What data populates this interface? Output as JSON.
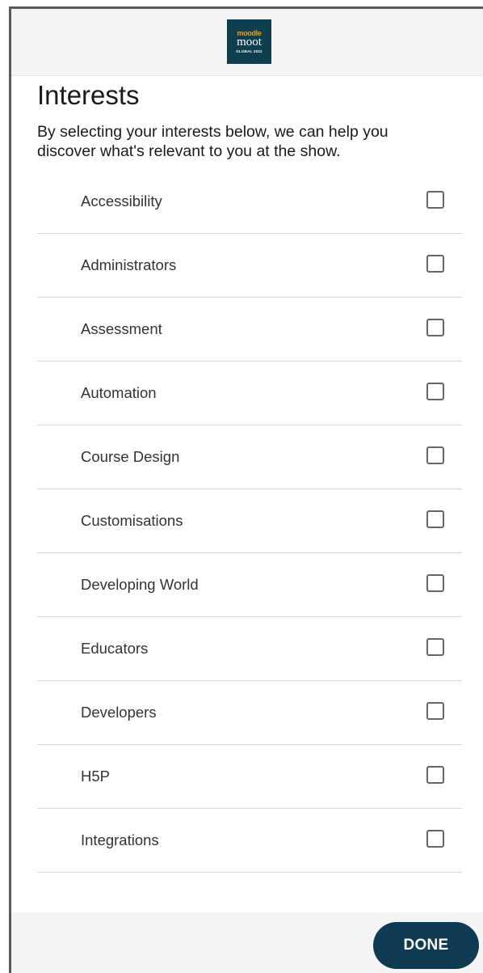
{
  "header": {
    "logo": {
      "text_top": "moodle",
      "text_mid": "moot",
      "text_bottom": "GLOBAL 2022",
      "background": "#0e3f4f",
      "accent": "#f39c12"
    }
  },
  "page": {
    "title": "Interests",
    "intro": "By selecting your interests below, we can help you discover what's relevant to you at the show."
  },
  "interests": [
    {
      "label": "Accessibility",
      "checked": false
    },
    {
      "label": "Administrators",
      "checked": false
    },
    {
      "label": "Assessment",
      "checked": false
    },
    {
      "label": "Automation",
      "checked": false
    },
    {
      "label": "Course Design",
      "checked": false
    },
    {
      "label": "Customisations",
      "checked": false
    },
    {
      "label": "Developing World",
      "checked": false
    },
    {
      "label": "Educators",
      "checked": false
    },
    {
      "label": "Developers",
      "checked": false
    },
    {
      "label": "H5P",
      "checked": false
    },
    {
      "label": "Integrations",
      "checked": false
    }
  ],
  "footer": {
    "done_label": "DONE",
    "button_color": "#0e3a53"
  }
}
